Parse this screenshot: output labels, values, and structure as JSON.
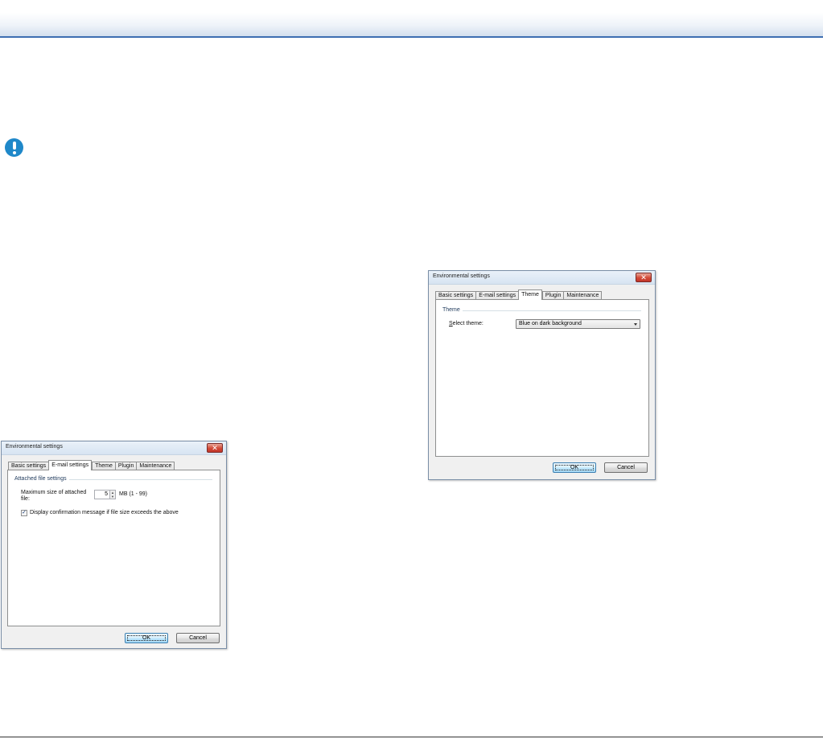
{
  "page": {
    "colors": {
      "header_rule": "#3e6fb2",
      "alert_icon": "#1f88c9"
    },
    "icons": {
      "alert": "exclamation-circle-icon"
    }
  },
  "dialog_email": {
    "title": "Environmental settings",
    "close_icon": "close-icon",
    "tabs": [
      "Basic settings",
      "E-mail settings",
      "Theme",
      "Plugin",
      "Maintenance"
    ],
    "active_tab": "E-mail settings",
    "group_title": "Attached file settings",
    "max_size_label_line1": "Maximum size of attached",
    "max_size_label_line2": "file:",
    "max_size_value": "5",
    "max_size_unit": "MB (1 - 99)",
    "confirm_checkbox_label": "Display confirmation message if file size exceeds the above",
    "confirm_checked": true,
    "ok_label": "OK",
    "cancel_label": "Cancel"
  },
  "dialog_theme": {
    "title": "Environmental settings",
    "close_icon": "close-icon",
    "tabs": [
      "Basic settings",
      "E-mail settings",
      "Theme",
      "Plugin",
      "Maintenance"
    ],
    "active_tab": "Theme",
    "group_title": "Theme",
    "select_label": "Select theme:",
    "select_value": "Blue on dark background",
    "ok_label": "OK",
    "cancel_label": "Cancel"
  }
}
